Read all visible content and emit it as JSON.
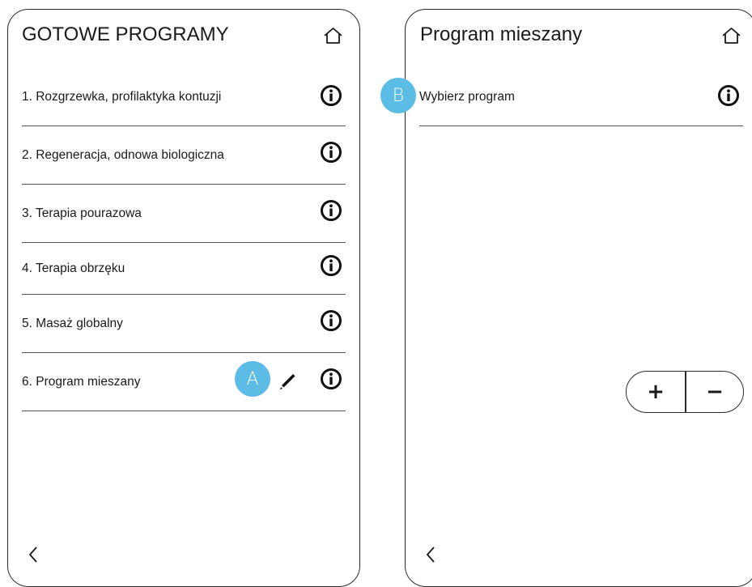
{
  "colors": {
    "badge": "#5bbde6",
    "border": "#2b2b2b",
    "text": "#1a1a1a"
  },
  "left_screen": {
    "title": "GOTOWE PROGRAMY",
    "home_icon": "home-icon",
    "items": [
      {
        "label": "1. Rozgrzewka, profilaktyka kontuzji",
        "icon": "info-icon"
      },
      {
        "label": "2. Regeneracja, odnowa biologiczna",
        "icon": "info-icon"
      },
      {
        "label": "3. Terapia pourazowa",
        "icon": "info-icon"
      },
      {
        "label": "4. Terapia obrzęku",
        "icon": "info-icon"
      },
      {
        "label": "5. Masaż globalny",
        "icon": "info-icon"
      },
      {
        "label": "6. Program mieszany",
        "icon": "info-icon",
        "edit_icon": "pencil-icon",
        "badge": "A"
      }
    ],
    "back_icon": "chevron-left-icon"
  },
  "right_screen": {
    "title": "Program mieszany",
    "home_icon": "home-icon",
    "items": [
      {
        "label": "Wybierz program",
        "icon": "info-icon",
        "badge": "B"
      }
    ],
    "stepper": {
      "plus_label": "+",
      "minus_label": "−"
    },
    "back_icon": "chevron-left-icon"
  }
}
